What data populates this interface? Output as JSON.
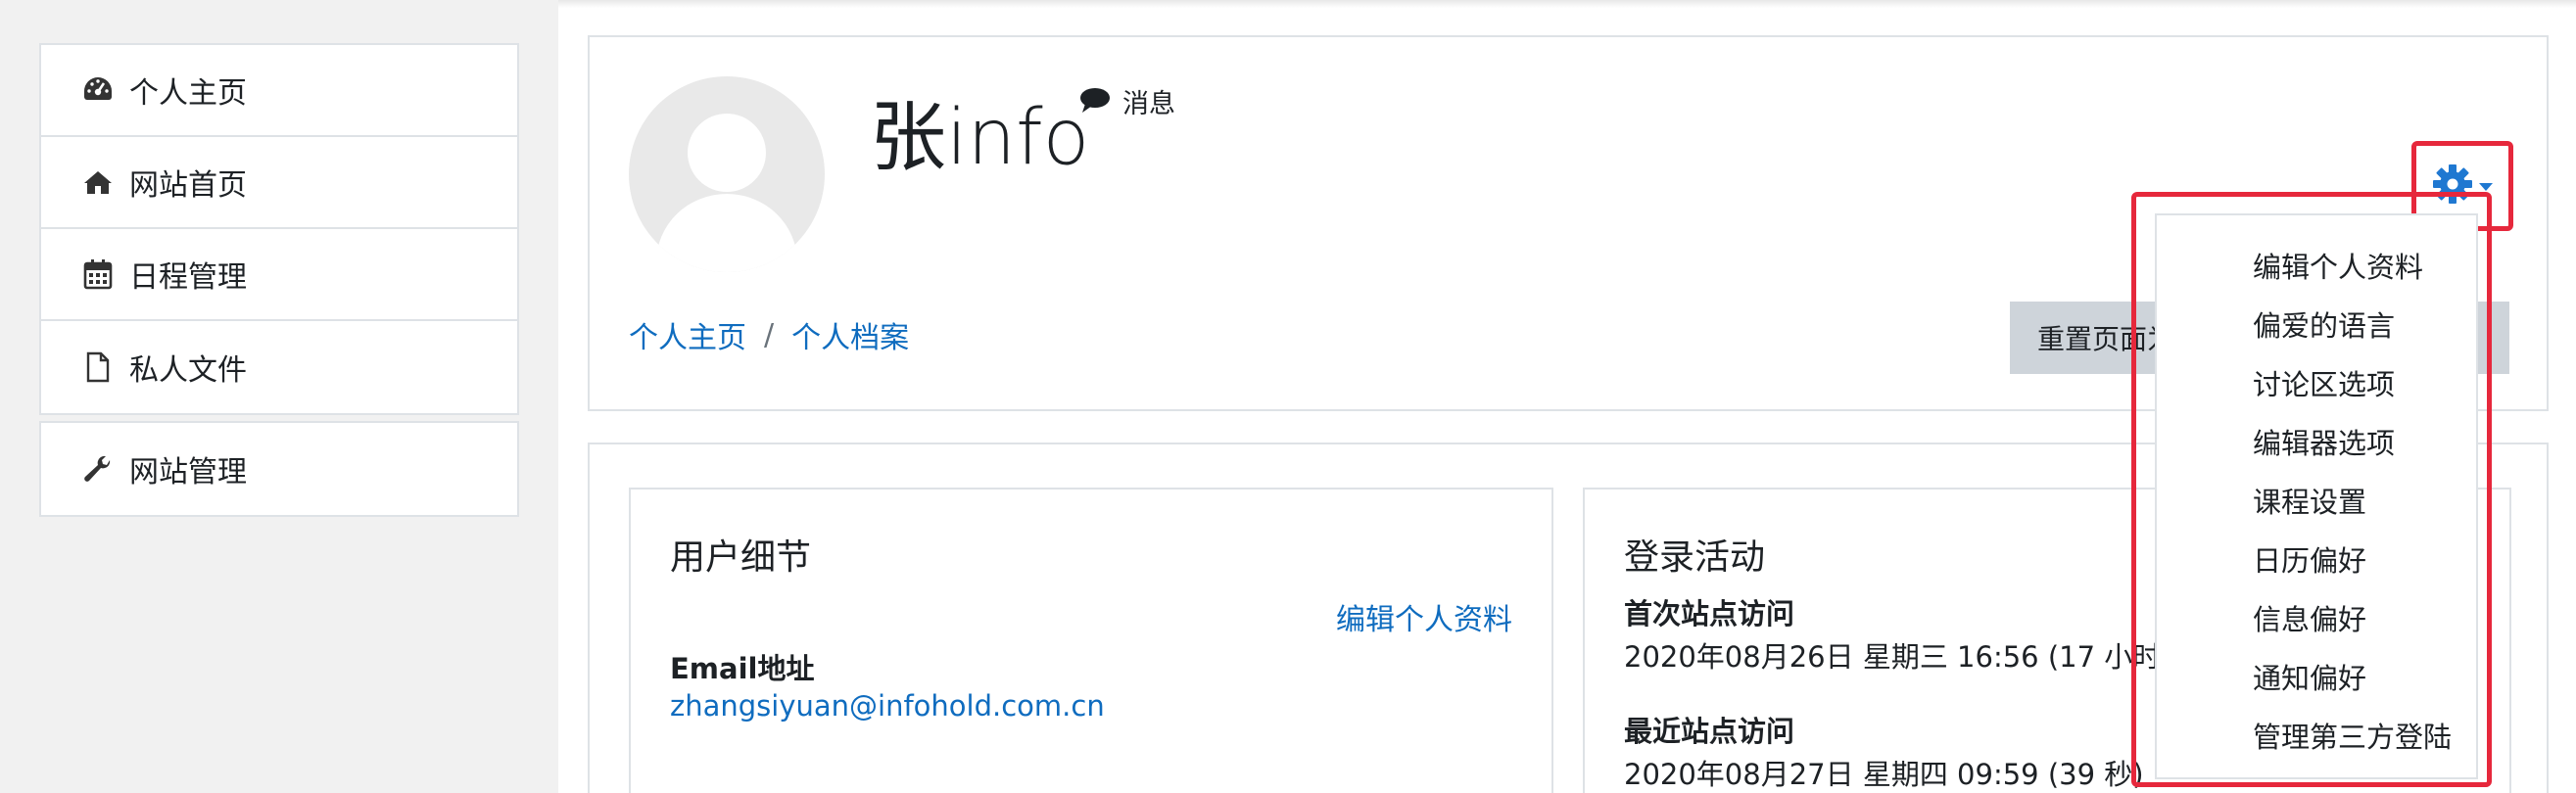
{
  "sidebar": {
    "group1": [
      {
        "label": "个人主页",
        "icon": "dashboard-icon"
      },
      {
        "label": "网站首页",
        "icon": "home-icon"
      },
      {
        "label": "日程管理",
        "icon": "calendar-icon"
      },
      {
        "label": "私人文件",
        "icon": "file-icon"
      }
    ],
    "group2": [
      {
        "label": "网站管理",
        "icon": "wrench-icon"
      }
    ]
  },
  "header": {
    "title": "张info",
    "message_label": "消息",
    "breadcrumb": [
      "个人主页",
      "个人档案"
    ],
    "breadcrumb_sep": "/",
    "reset_button": "重置页面为默认"
  },
  "user_details": {
    "heading": "用户细节",
    "edit_link": "编辑个人资料",
    "email_label": "Email地址",
    "email_value": "zhangsiyuan@infohold.com.cn"
  },
  "login_activity": {
    "heading": "登录活动",
    "first_access_label": "首次站点访问",
    "first_access_value": "2020年08月26日 星期三 16:56  (17 小时)",
    "last_access_label": "最近站点访问",
    "last_access_value": "2020年08月27日 星期四 09:59  (39 秒)"
  },
  "dropdown": {
    "items": [
      "编辑个人资料",
      "偏爱的语言",
      "讨论区选项",
      "编辑器选项",
      "课程设置",
      "日历偏好",
      "信息偏好",
      "通知偏好",
      "管理第三方登陆"
    ]
  },
  "colors": {
    "link": "#0f6cbf",
    "highlight": "#e6283c",
    "gear": "#1f78d1"
  }
}
